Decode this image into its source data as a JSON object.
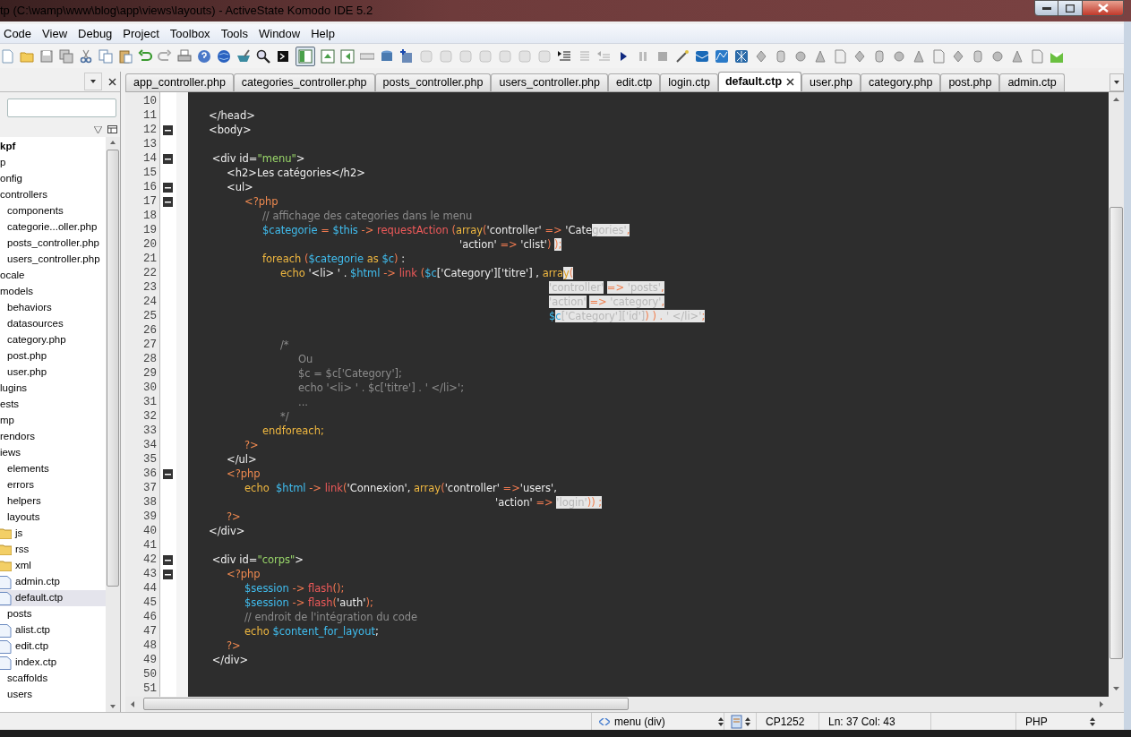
{
  "window": {
    "title": "tp (C:\\wamp\\www\\blog\\app\\views\\layouts) - ActiveState Komodo IDE 5.2"
  },
  "menu": [
    "Code",
    "View",
    "Debug",
    "Project",
    "Toolbox",
    "Tools",
    "Window",
    "Help"
  ],
  "project_tree": [
    {
      "label": "kpf",
      "kind": "project",
      "selected": false
    },
    {
      "label": "p",
      "kind": "node",
      "selected": false
    },
    {
      "label": "onfig",
      "kind": "node",
      "selected": false
    },
    {
      "label": "controllers",
      "kind": "node",
      "selected": false,
      "children": [
        {
          "label": "components",
          "kind": "node",
          "selected": false
        },
        {
          "label": "categorie...oller.php",
          "kind": "node",
          "selected": false
        },
        {
          "label": "posts_controller.php",
          "kind": "node",
          "selected": false
        },
        {
          "label": "users_controller.php",
          "kind": "node",
          "selected": false
        }
      ]
    },
    {
      "label": "ocale",
      "kind": "node",
      "selected": false
    },
    {
      "label": "models",
      "kind": "node",
      "selected": false,
      "children": [
        {
          "label": "behaviors",
          "kind": "node",
          "selected": false
        },
        {
          "label": "datasources",
          "kind": "node",
          "selected": false
        },
        {
          "label": "category.php",
          "kind": "node",
          "selected": false
        },
        {
          "label": "post.php",
          "kind": "node",
          "selected": false
        },
        {
          "label": "user.php",
          "kind": "node",
          "selected": false
        }
      ]
    },
    {
      "label": "lugins",
      "kind": "node",
      "selected": false
    },
    {
      "label": "ests",
      "kind": "node",
      "selected": false
    },
    {
      "label": "mp",
      "kind": "node",
      "selected": false
    },
    {
      "label": "rendors",
      "kind": "node",
      "selected": false
    },
    {
      "label": "iews",
      "kind": "node",
      "selected": false,
      "children": [
        {
          "label": "elements",
          "kind": "node",
          "selected": false
        },
        {
          "label": "errors",
          "kind": "node",
          "selected": false
        },
        {
          "label": "helpers",
          "kind": "node",
          "selected": false
        },
        {
          "label": "layouts",
          "kind": "node",
          "selected": false,
          "children": [
            {
              "label": "js",
              "kind": "folder",
              "selected": false
            },
            {
              "label": "rss",
              "kind": "folder",
              "selected": false
            },
            {
              "label": "xml",
              "kind": "folder",
              "selected": false
            },
            {
              "label": "admin.ctp",
              "kind": "file",
              "selected": false
            },
            {
              "label": "default.ctp",
              "kind": "file",
              "selected": true
            }
          ]
        },
        {
          "label": "posts",
          "kind": "node",
          "selected": false,
          "children": [
            {
              "label": "alist.ctp",
              "kind": "file",
              "selected": false
            },
            {
              "label": "edit.ctp",
              "kind": "file",
              "selected": false
            },
            {
              "label": "index.ctp",
              "kind": "file",
              "selected": false
            }
          ]
        },
        {
          "label": "scaffolds",
          "kind": "node",
          "selected": false
        },
        {
          "label": "users",
          "kind": "node",
          "selected": false
        }
      ]
    }
  ],
  "tabs": [
    {
      "label": "app_controller.php",
      "selected": false
    },
    {
      "label": "categories_controller.php",
      "selected": false
    },
    {
      "label": "posts_controller.php",
      "selected": false
    },
    {
      "label": "users_controller.php",
      "selected": false
    },
    {
      "label": "edit.ctp",
      "selected": false
    },
    {
      "label": "login.ctp",
      "selected": false
    },
    {
      "label": "default.ctp",
      "selected": true
    },
    {
      "label": "user.php",
      "selected": false
    },
    {
      "label": "category.php",
      "selected": false
    },
    {
      "label": "post.php",
      "selected": false
    },
    {
      "label": "admin.ctp",
      "selected": false
    }
  ],
  "editor": {
    "lines": [
      {
        "n": "10",
        "fold": false
      },
      {
        "n": "11",
        "fold": false,
        "tokens": [
          {
            "t": "\t</head>",
            "kind": "plain"
          }
        ]
      },
      {
        "n": "12",
        "fold": true,
        "tokens": [
          {
            "t": "\t<body>",
            "kind": "plain"
          }
        ]
      },
      {
        "n": "13",
        "fold": false
      },
      {
        "n": "14",
        "fold": true,
        "tokens": [
          {
            "t": "\t <div id=",
            "kind": "plain"
          },
          {
            "t": "\"menu\"",
            "kind": "attr"
          },
          {
            "t": ">",
            "kind": "plain"
          }
        ]
      },
      {
        "n": "15",
        "fold": false,
        "tokens": [
          {
            "t": "\t\t<h2>Les catégories</h2>",
            "kind": "plain"
          }
        ]
      },
      {
        "n": "16",
        "fold": true,
        "tokens": [
          {
            "t": "\t\t<ul>",
            "kind": "plain"
          }
        ]
      },
      {
        "n": "17",
        "fold": true,
        "tokens": [
          {
            "t": "\t\t\t<?php",
            "kind": "php"
          }
        ]
      },
      {
        "n": "18",
        "fold": false,
        "tokens": [
          {
            "t": "\t\t\t\t// affichage des categories dans le menu",
            "kind": "comment"
          }
        ]
      },
      {
        "n": "19",
        "fold": false,
        "tokens": [
          {
            "t": "\t\t\t\t$categorie",
            "kind": "var",
            "selected": false
          },
          {
            "t": " = ",
            "kind": "op",
            "selected": false
          },
          {
            "t": "$this",
            "kind": "var",
            "selected": false
          },
          {
            "t": " -> ",
            "kind": "op",
            "selected": false
          },
          {
            "t": "requestAction",
            "kind": "fn",
            "selected": false
          },
          {
            "t": " (",
            "kind": "op",
            "selected": false
          },
          {
            "t": "array",
            "kind": "kw",
            "selected": false
          },
          {
            "t": "(",
            "kind": "op",
            "selected": false
          },
          {
            "t": "'controller'",
            "kind": "str",
            "selected": false
          },
          {
            "t": " => ",
            "kind": "op",
            "selected": false
          },
          {
            "t": "'Cate",
            "kind": "str",
            "selected": false
          },
          {
            "t": "gories'",
            "kind": "str",
            "selected": true
          },
          {
            "t": ",",
            "kind": "op",
            "selected": true
          }
        ]
      },
      {
        "n": "20",
        "fold": false,
        "tokens": [
          {
            "t": "\t\t\t\t\t\t\t\t\t\t\t\t\t\t\t'action'",
            "kind": "str",
            "selected": false
          },
          {
            "t": " => ",
            "kind": "op",
            "selected": false
          },
          {
            "t": "'clist'",
            "kind": "str",
            "selected": false
          },
          {
            "t": ")",
            "kind": "op",
            "selected": false
          },
          {
            "t": " );",
            "kind": "op",
            "selected": true
          }
        ]
      },
      {
        "n": "21",
        "fold": false,
        "tokens": [
          {
            "t": "\t\t\t\tforeach",
            "kind": "kw"
          },
          {
            "t": " (",
            "kind": "op"
          },
          {
            "t": "$categorie",
            "kind": "var"
          },
          {
            "t": " as ",
            "kind": "kw"
          },
          {
            "t": "$c",
            "kind": "var"
          },
          {
            "t": ")",
            "kind": "op"
          },
          {
            "t": " :",
            "kind": "plain"
          }
        ]
      },
      {
        "n": "22",
        "fold": false,
        "tokens": [
          {
            "t": "\t\t\t\t\techo",
            "kind": "kw",
            "selected": false
          },
          {
            "t": " '<li> '",
            "kind": "str",
            "selected": false
          },
          {
            "t": " . ",
            "kind": "plain",
            "selected": false
          },
          {
            "t": "$html",
            "kind": "var",
            "selected": false
          },
          {
            "t": " -> ",
            "kind": "op",
            "selected": false
          },
          {
            "t": "link",
            "kind": "fn",
            "selected": false
          },
          {
            "t": " (",
            "kind": "op",
            "selected": false
          },
          {
            "t": "$c",
            "kind": "var",
            "selected": false
          },
          {
            "t": "['Category']['titre']",
            "kind": "str",
            "selected": false
          },
          {
            "t": " , ",
            "kind": "plain",
            "selected": false
          },
          {
            "t": "arra",
            "kind": "kw",
            "selected": false
          },
          {
            "t": "y",
            "kind": "kw",
            "selected": true
          },
          {
            "t": "(",
            "kind": "op",
            "selected": true
          }
        ]
      },
      {
        "n": "23",
        "fold": false,
        "tokens": [
          {
            "t": "\t\t\t\t\t\t\t\t\t\t\t\t\t\t\t\t\t\t\t\t'controller'",
            "kind": "str",
            "selected": true
          },
          {
            "t": " => ",
            "kind": "op",
            "selected": true
          },
          {
            "t": "'posts'",
            "kind": "str",
            "selected": true
          },
          {
            "t": ",",
            "kind": "op",
            "selected": true
          }
        ]
      },
      {
        "n": "24",
        "fold": false,
        "tokens": [
          {
            "t": "\t\t\t\t\t\t\t\t\t\t\t\t\t\t\t\t\t\t\t\t'action'",
            "kind": "str",
            "selected": true
          },
          {
            "t": " => ",
            "kind": "op",
            "selected": true
          },
          {
            "t": "'category'",
            "kind": "str",
            "selected": true
          },
          {
            "t": ",",
            "kind": "op",
            "selected": true
          }
        ]
      },
      {
        "n": "25",
        "fold": false,
        "tokens": [
          {
            "t": "\t\t\t\t\t\t\t\t\t\t\t\t\t\t\t\t\t\t\t\t$",
            "kind": "var",
            "selected": false
          },
          {
            "t": "c",
            "kind": "var",
            "selected": true
          },
          {
            "t": "['Category']['id']",
            "kind": "str",
            "selected": true
          },
          {
            "t": ") ) . ",
            "kind": "op",
            "selected": true
          },
          {
            "t": "' </li>'",
            "kind": "str",
            "selected": true
          },
          {
            "t": ";",
            "kind": "op",
            "selected": true
          }
        ]
      },
      {
        "n": "26",
        "fold": false
      },
      {
        "n": "27",
        "fold": false,
        "tokens": [
          {
            "t": "\t\t\t\t\t/*",
            "kind": "comment"
          }
        ]
      },
      {
        "n": "28",
        "fold": false,
        "tokens": [
          {
            "t": "\t\t\t\t\t\tOu",
            "kind": "comment"
          }
        ]
      },
      {
        "n": "29",
        "fold": false,
        "tokens": [
          {
            "t": "\t\t\t\t\t\t$c = $c['Category'];",
            "kind": "comment"
          }
        ]
      },
      {
        "n": "30",
        "fold": false,
        "tokens": [
          {
            "t": "\t\t\t\t\t\techo '<li> ' . $c['titre'] . ' </li>';",
            "kind": "comment"
          }
        ]
      },
      {
        "n": "31",
        "fold": false,
        "tokens": [
          {
            "t": "\t\t\t\t\t\t...",
            "kind": "comment"
          }
        ]
      },
      {
        "n": "32",
        "fold": false,
        "tokens": [
          {
            "t": "\t\t\t\t\t*/",
            "kind": "comment"
          }
        ]
      },
      {
        "n": "33",
        "fold": false,
        "tokens": [
          {
            "t": "\t\t\t\tendforeach;",
            "kind": "kw"
          }
        ]
      },
      {
        "n": "34",
        "fold": false,
        "tokens": [
          {
            "t": "\t\t\t?>",
            "kind": "php"
          }
        ]
      },
      {
        "n": "35",
        "fold": false,
        "tokens": [
          {
            "t": "\t\t</ul>",
            "kind": "plain"
          }
        ]
      },
      {
        "n": "36",
        "fold": true,
        "tokens": [
          {
            "t": "\t\t<?php",
            "kind": "php"
          }
        ]
      },
      {
        "n": "37",
        "fold": false,
        "tokens": [
          {
            "t": "\t\t\techo  ",
            "kind": "kw"
          },
          {
            "t": "$html",
            "kind": "var"
          },
          {
            "t": " -> ",
            "kind": "op"
          },
          {
            "t": "link",
            "kind": "fn"
          },
          {
            "t": "(",
            "kind": "op"
          },
          {
            "t": "'Connexion'",
            "kind": "str"
          },
          {
            "t": ", ",
            "kind": "plain"
          },
          {
            "t": "array",
            "kind": "kw"
          },
          {
            "t": "(",
            "kind": "op"
          },
          {
            "t": "'controller'",
            "kind": "str"
          },
          {
            "t": " =>",
            "kind": "op"
          },
          {
            "t": "'users',",
            "kind": "str"
          }
        ]
      },
      {
        "n": "38",
        "fold": false,
        "tokens": [
          {
            "t": "\t\t\t\t\t\t\t\t\t\t\t\t\t\t\t\t\t'action'",
            "kind": "str",
            "selected": false
          },
          {
            "t": " => ",
            "kind": "op",
            "selected": false
          },
          {
            "t": "'login'",
            "kind": "str",
            "selected": true
          },
          {
            "t": ")) ;",
            "kind": "op",
            "selected": true
          }
        ]
      },
      {
        "n": "39",
        "fold": false,
        "tokens": [
          {
            "t": "\t\t?>",
            "kind": "php"
          }
        ]
      },
      {
        "n": "40",
        "fold": false,
        "tokens": [
          {
            "t": "\t</div>",
            "kind": "plain"
          }
        ]
      },
      {
        "n": "41",
        "fold": false
      },
      {
        "n": "42",
        "fold": true,
        "tokens": [
          {
            "t": "\t <div id=",
            "kind": "plain"
          },
          {
            "t": "\"corps\"",
            "kind": "attr"
          },
          {
            "t": ">",
            "kind": "plain"
          }
        ]
      },
      {
        "n": "43",
        "fold": true,
        "tokens": [
          {
            "t": "\t\t<?php",
            "kind": "php"
          }
        ]
      },
      {
        "n": "44",
        "fold": false,
        "tokens": [
          {
            "t": "\t\t\t$session",
            "kind": "var"
          },
          {
            "t": " -> ",
            "kind": "op"
          },
          {
            "t": "flash",
            "kind": "fn"
          },
          {
            "t": "();",
            "kind": "op"
          }
        ]
      },
      {
        "n": "45",
        "fold": false,
        "tokens": [
          {
            "t": "\t\t\t$session",
            "kind": "var"
          },
          {
            "t": " -> ",
            "kind": "op"
          },
          {
            "t": "flash",
            "kind": "fn"
          },
          {
            "t": "(",
            "kind": "op"
          },
          {
            "t": "'auth'",
            "kind": "str"
          },
          {
            "t": ");",
            "kind": "op"
          }
        ]
      },
      {
        "n": "46",
        "fold": false,
        "tokens": [
          {
            "t": "\t\t\t// endroit de l'intégration du code",
            "kind": "comment"
          }
        ]
      },
      {
        "n": "47",
        "fold": false,
        "tokens": [
          {
            "t": "\t\t\techo ",
            "kind": "kw"
          },
          {
            "t": "$content_for_layout",
            "kind": "var"
          },
          {
            "t": ";",
            "kind": "plain"
          }
        ]
      },
      {
        "n": "48",
        "fold": false,
        "tokens": [
          {
            "t": "\t\t?>",
            "kind": "php"
          }
        ]
      },
      {
        "n": "49",
        "fold": false,
        "tokens": [
          {
            "t": "\t </div>",
            "kind": "plain"
          }
        ]
      },
      {
        "n": "50",
        "fold": false
      },
      {
        "n": "51",
        "fold": false
      }
    ]
  },
  "status_bar": {
    "section": "menu (div)",
    "encoding": "CP1252",
    "position": "Ln: 37 Col: 43",
    "language": "PHP"
  }
}
